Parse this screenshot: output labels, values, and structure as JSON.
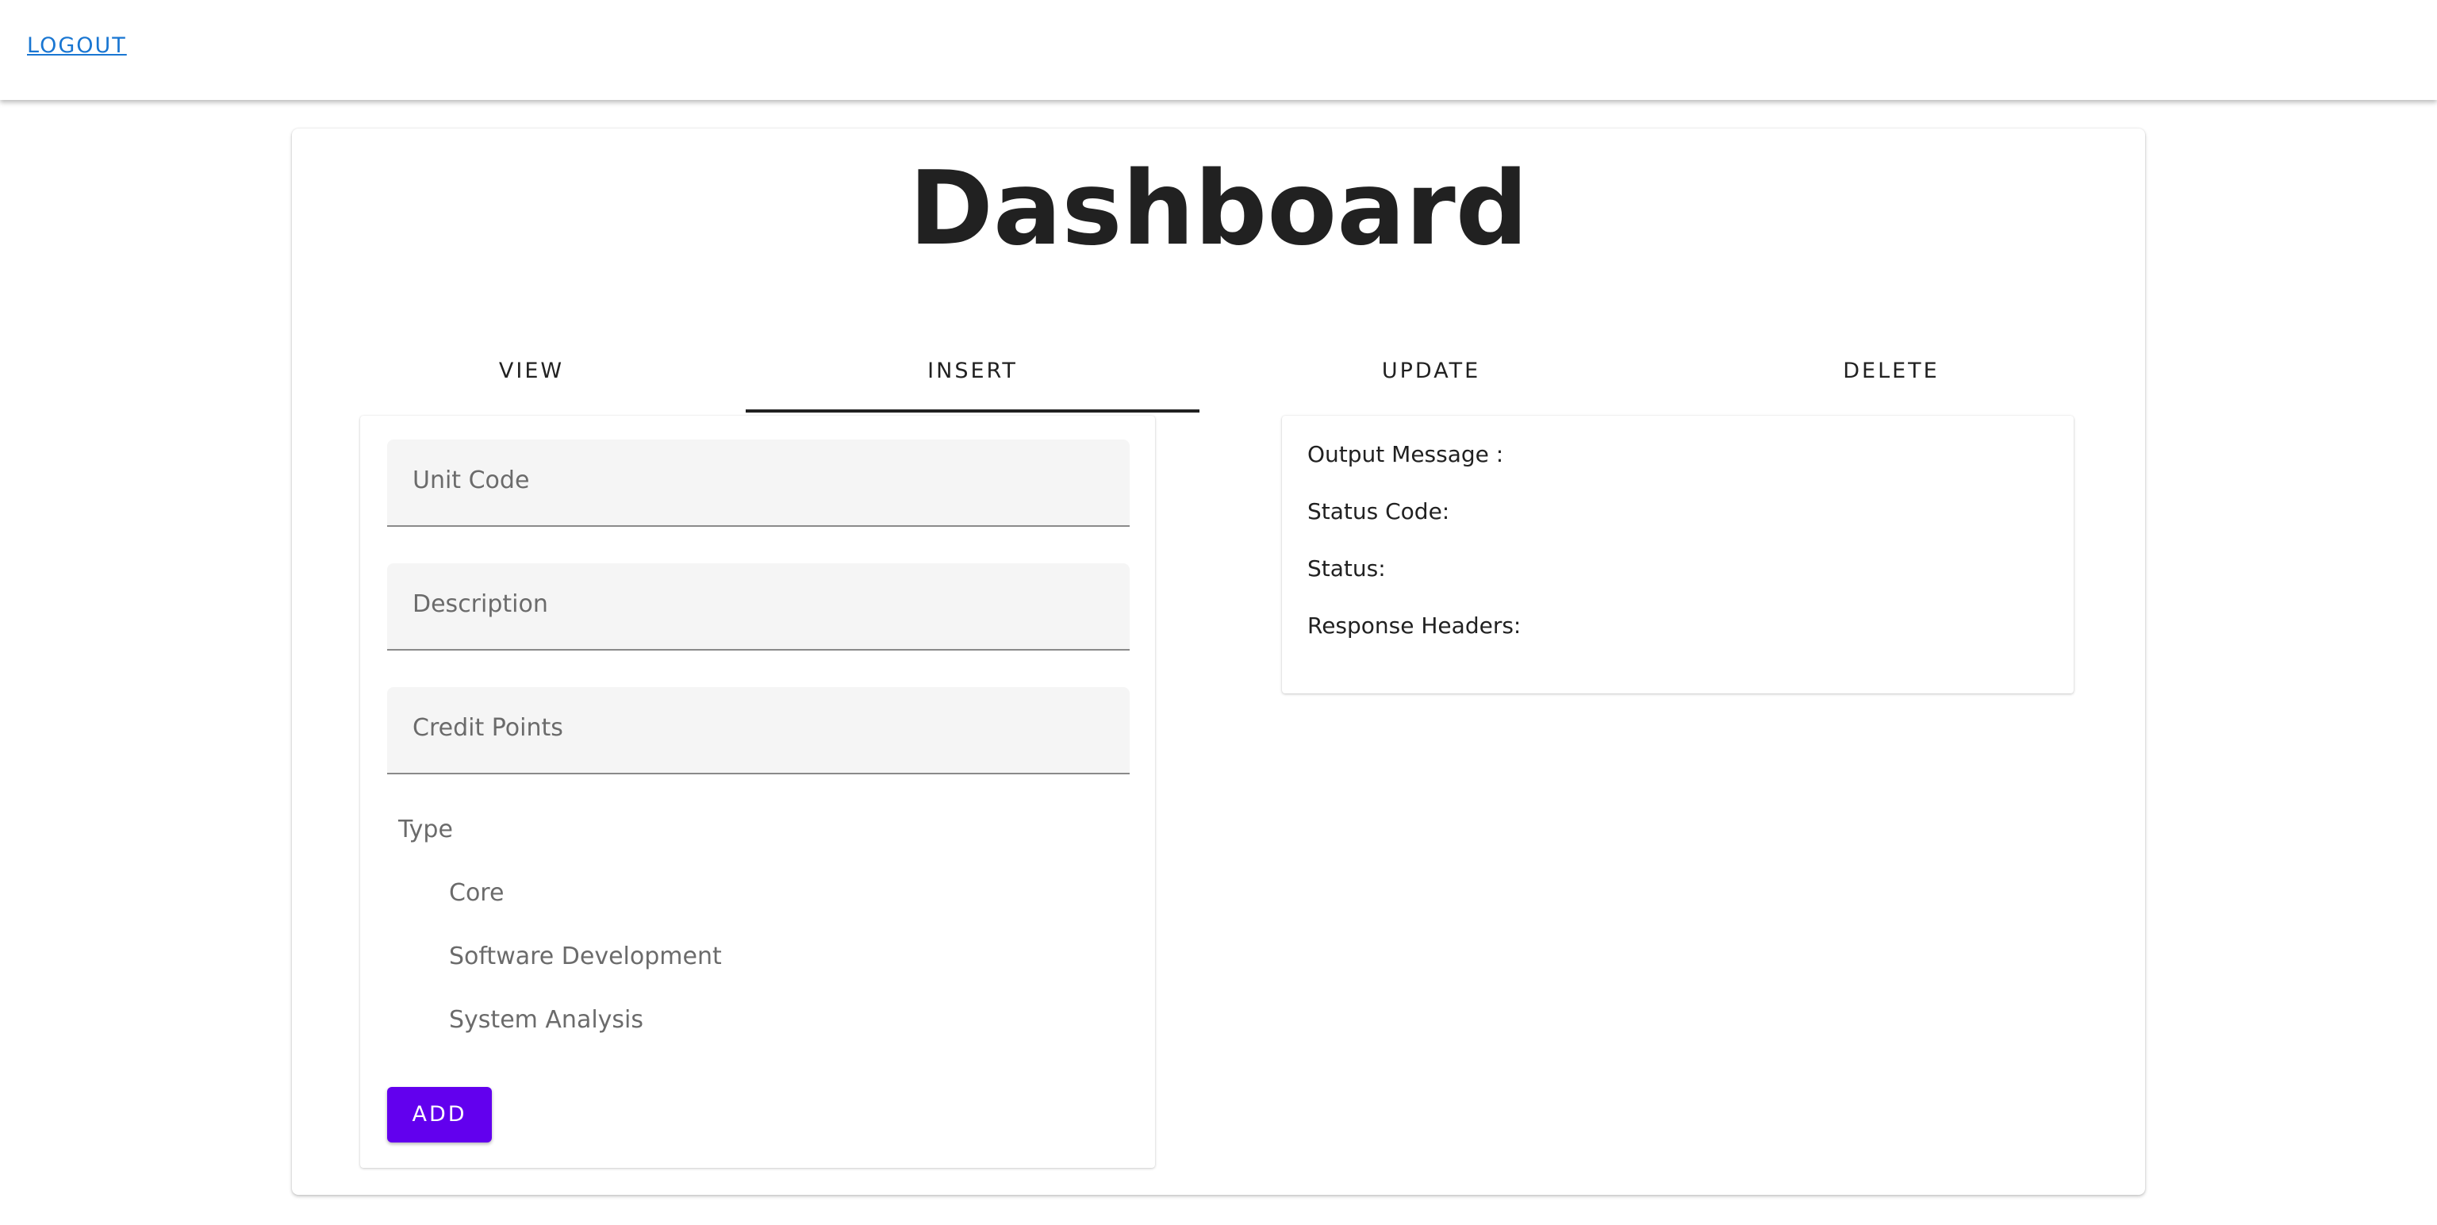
{
  "header": {
    "logout_label": "LOGOUT"
  },
  "page": {
    "title": "Dashboard"
  },
  "tabs": [
    {
      "label": "VIEW",
      "active": false
    },
    {
      "label": "INSERT",
      "active": true
    },
    {
      "label": "UPDATE",
      "active": false
    },
    {
      "label": "DELETE",
      "active": false
    }
  ],
  "form": {
    "fields": [
      {
        "label": "Unit Code",
        "value": ""
      },
      {
        "label": "Description",
        "value": ""
      },
      {
        "label": "Credit Points",
        "value": ""
      }
    ],
    "type_label": "Type",
    "type_options": [
      "Core",
      "Software Development",
      "System Analysis"
    ],
    "add_label": "ADD"
  },
  "output": {
    "message_label": "Output Message :",
    "status_code_label": "Status Code:",
    "status_label": "Status:",
    "headers_label": "Response Headers:"
  },
  "colors": {
    "accent": "#6200ee",
    "link": "#1976d2",
    "text": "#212121",
    "muted": "#6b6b6b",
    "field_bg": "#f5f5f5"
  }
}
